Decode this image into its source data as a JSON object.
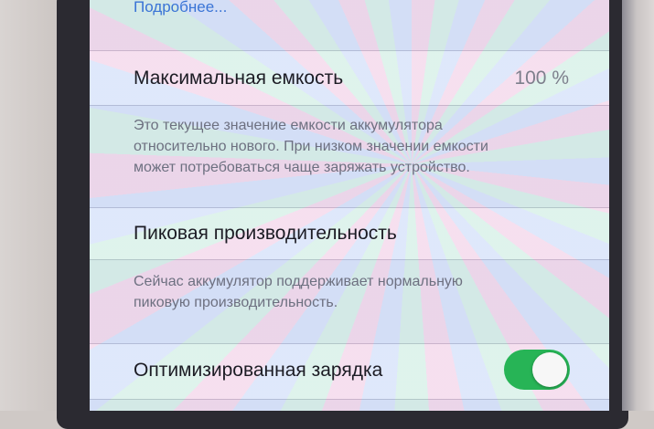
{
  "header": {
    "more_link": "Подробнее..."
  },
  "max_capacity": {
    "label": "Максимальная емкость",
    "value": "100 %",
    "footer": [
      "Это текущее значение емкости аккумулятора",
      "относительно нового. При низком значении емкости",
      "может потребоваться чаще заряжать устройство."
    ]
  },
  "peak_performance": {
    "label": "Пиковая производительность",
    "footer": [
      "Сейчас аккумулятор поддерживает нормальную",
      "пиковую производительность."
    ]
  },
  "optimized_charging": {
    "label": "Оптимизированная зарядка",
    "enabled": true
  },
  "colors": {
    "accent_link": "#3a74d6",
    "toggle_on": "#27b456"
  }
}
